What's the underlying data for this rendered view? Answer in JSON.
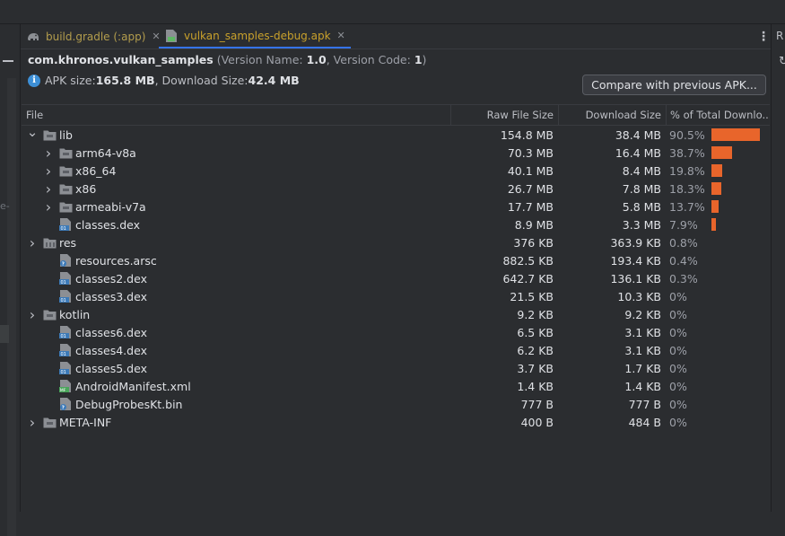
{
  "tabs": [
    {
      "label": "build.gradle (:app)",
      "icon": "gradle-elephant-icon",
      "active": false
    },
    {
      "label": "vulkan_samples-debug.apk",
      "icon": "apk-file-icon",
      "active": true
    }
  ],
  "right_panel": {
    "label": "R",
    "kebab": "⋮",
    "refresh": "↻"
  },
  "left_gutter": {
    "edge_text": "e-"
  },
  "package": {
    "name": "com.khronos.vulkan_samples",
    "version_name_label": "(Version Name: ",
    "version_name": "1.0",
    "version_code_label": ", Version Code: ",
    "version_code": "1",
    "close_paren": ")"
  },
  "summary": {
    "apk_label": "APK size: ",
    "apk_size": "165.8 MB",
    "download_label": ", Download Size: ",
    "download_size": "42.4 MB"
  },
  "compare_button": "Compare with previous APK...",
  "columns": {
    "file": "File",
    "raw": "Raw File Size",
    "download": "Download Size",
    "percent": "% of Total Downlo..."
  },
  "rows": [
    {
      "name": "lib",
      "indent": 0,
      "arrow": "down",
      "icon": "folder",
      "raw": "154.8 MB",
      "dl": "38.4 MB",
      "pct": "90.5%",
      "frac": 0.905
    },
    {
      "name": "arm64-v8a",
      "indent": 1,
      "arrow": "right",
      "icon": "folder",
      "raw": "70.3 MB",
      "dl": "16.4 MB",
      "pct": "38.7%",
      "frac": 0.387
    },
    {
      "name": "x86_64",
      "indent": 1,
      "arrow": "right",
      "icon": "folder",
      "raw": "40.1 MB",
      "dl": "8.4 MB",
      "pct": "19.8%",
      "frac": 0.198
    },
    {
      "name": "x86",
      "indent": 1,
      "arrow": "right",
      "icon": "folder",
      "raw": "26.7 MB",
      "dl": "7.8 MB",
      "pct": "18.3%",
      "frac": 0.183
    },
    {
      "name": "armeabi-v7a",
      "indent": 1,
      "arrow": "right",
      "icon": "folder",
      "raw": "17.7 MB",
      "dl": "5.8 MB",
      "pct": "13.7%",
      "frac": 0.137
    },
    {
      "name": "classes.dex",
      "indent": 1,
      "arrow": "none",
      "icon": "dex",
      "raw": "8.9 MB",
      "dl": "3.3 MB",
      "pct": "7.9%",
      "frac": 0.079
    },
    {
      "name": "res",
      "indent": 0,
      "arrow": "right",
      "icon": "res-folder",
      "raw": "376 KB",
      "dl": "363.9 KB",
      "pct": "0.8%",
      "frac": 0
    },
    {
      "name": "resources.arsc",
      "indent": 1,
      "arrow": "none",
      "icon": "unknown-file",
      "raw": "882.5 KB",
      "dl": "193.4 KB",
      "pct": "0.4%",
      "frac": 0
    },
    {
      "name": "classes2.dex",
      "indent": 1,
      "arrow": "none",
      "icon": "dex",
      "raw": "642.7 KB",
      "dl": "136.1 KB",
      "pct": "0.3%",
      "frac": 0
    },
    {
      "name": "classes3.dex",
      "indent": 1,
      "arrow": "none",
      "icon": "dex",
      "raw": "21.5 KB",
      "dl": "10.3 KB",
      "pct": "0%",
      "frac": 0
    },
    {
      "name": "kotlin",
      "indent": 0,
      "arrow": "right",
      "icon": "folder",
      "raw": "9.2 KB",
      "dl": "9.2 KB",
      "pct": "0%",
      "frac": 0
    },
    {
      "name": "classes6.dex",
      "indent": 1,
      "arrow": "none",
      "icon": "dex",
      "raw": "6.5 KB",
      "dl": "3.1 KB",
      "pct": "0%",
      "frac": 0
    },
    {
      "name": "classes4.dex",
      "indent": 1,
      "arrow": "none",
      "icon": "dex",
      "raw": "6.2 KB",
      "dl": "3.1 KB",
      "pct": "0%",
      "frac": 0
    },
    {
      "name": "classes5.dex",
      "indent": 1,
      "arrow": "none",
      "icon": "dex",
      "raw": "3.7 KB",
      "dl": "1.7 KB",
      "pct": "0%",
      "frac": 0
    },
    {
      "name": "AndroidManifest.xml",
      "indent": 1,
      "arrow": "none",
      "icon": "manifest",
      "raw": "1.4 KB",
      "dl": "1.4 KB",
      "pct": "0%",
      "frac": 0
    },
    {
      "name": "DebugProbesKt.bin",
      "indent": 1,
      "arrow": "none",
      "icon": "unknown-file",
      "raw": "777 B",
      "dl": "777 B",
      "pct": "0%",
      "frac": 0
    },
    {
      "name": "META-INF",
      "indent": 0,
      "arrow": "right",
      "icon": "folder",
      "raw": "400 B",
      "dl": "484 B",
      "pct": "0%",
      "frac": 0
    }
  ],
  "colors": {
    "bar": "#e8652b",
    "accent": "#3574f0",
    "background": "#2b2d30"
  }
}
